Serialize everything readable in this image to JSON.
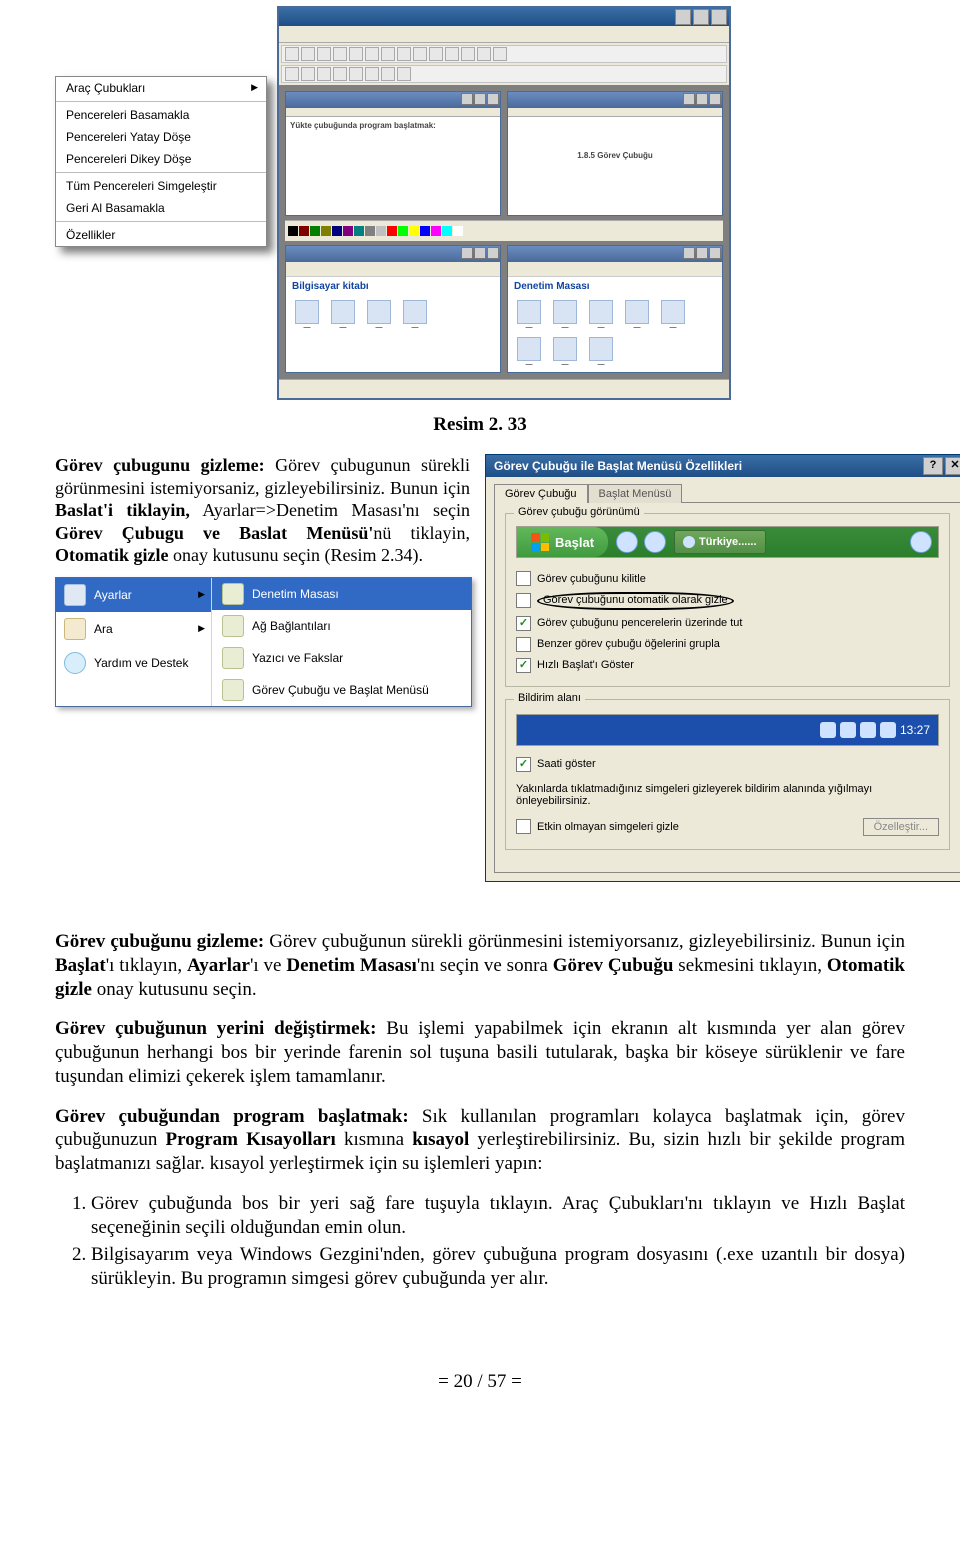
{
  "ctxMenu": {
    "items": [
      "Araç Çubukları",
      "Pencereleri Basamakla",
      "Pencereleri Yatay Döşe",
      "Pencereleri Dikey Döşe",
      "Tüm Pencereleri Simgeleştir",
      "Geri Al Basamakla",
      "Özellikler"
    ]
  },
  "mdi": {
    "topText1": "Yükte çubuğunda program başlatmak:",
    "topText2": "...",
    "paraHeading": "1.8.5 Görev Çubuğu",
    "folder1": "Bilgisayar kitabı",
    "folder2": "Denetim Masası"
  },
  "caption": "Resim 2. 33",
  "leadPara": {
    "strong1": "Görev çubugunu gizleme:",
    "t1": " Görev çubugunun    sürekli    görünmesini istemiyorsaniz, gizleyebilirsiniz. Bunun için ",
    "strong2": "Baslat'i  tiklayin,",
    "t2": " Ayarlar=>Denetim Masası'nı seçin ",
    "strong3": "Görev  Çubugu  ve  Baslat  Menüsü'",
    "t3": "nü tiklayin, ",
    "strong4": "Otomatik gizle",
    "t4": " onay kutusunu seçin (Resim 2.34)."
  },
  "startMenu": {
    "leftItems": [
      "Ayarlar",
      "Ara",
      "Yardım ve Destek"
    ],
    "rightItems": [
      "Denetim Masası",
      "Ağ Bağlantıları",
      "Yazıcı ve Fakslar",
      "Görev Çubuğu ve Başlat Menüsü"
    ]
  },
  "dialog": {
    "title": "Görev Çubuğu ile Başlat Menüsü Özellikleri",
    "tabs": [
      "Görev Çubuğu",
      "Başlat Menüsü"
    ],
    "fieldset1": "Görev çubuğu görünümü",
    "startLabel": "Başlat",
    "tbTabLabel": "Türkiye......",
    "options": [
      {
        "label": "Görev çubuğunu kilitle",
        "checked": false,
        "circled": false
      },
      {
        "label": "Görev çubuğunu otomatik olarak gizle",
        "checked": false,
        "circled": true
      },
      {
        "label": "Görev çubuğunu pencerelerin üzerinde tut",
        "checked": true,
        "circled": false
      },
      {
        "label": "Benzer görev çubuğu öğelerini grupla",
        "checked": false,
        "circled": false
      },
      {
        "label": "Hızlı Başlat'ı Göster",
        "checked": true,
        "circled": false
      }
    ],
    "fieldset2": "Bildirim alanı",
    "time": "13:27",
    "showClock": {
      "label": "Saati göster",
      "checked": true
    },
    "notifDesc": "Yakınlarda tıklatmadığınız simgeleri gizleyerek bildirim alanında yığılmayı önleyebilirsiniz.",
    "hideInactive": {
      "label": "Etkin olmayan simgeleri gizle",
      "checked": false
    },
    "customizeBtn": "Özelleştir..."
  },
  "body": {
    "p1": {
      "s1": "Görev çubuğunu gizleme:",
      "t1": " Görev çubuğunun sürekli görünmesini istemiyorsanız, gizleyebilirsiniz. Bunun için ",
      "s2": "Başlat",
      "t2": "'ı tıklayın, ",
      "s3": "Ayarlar",
      "t3": "'ı ve ",
      "s4": "Denetim Masası",
      "t4": "'nı seçin ve sonra ",
      "s5": "Görev Çubuğu",
      "t5": " sekmesini tıklayın, ",
      "s6": "Otomatik gizle",
      "t6": " onay kutusunu seçin."
    },
    "p2": {
      "s1": "Görev çubuğunun yerini değiştirmek:",
      "t1": " Bu işlemi yapabilmek için ekranın alt kısmında yer alan görev çubuğunun herhangi bos bir yerinde farenin sol tuşuna basili tutularak, başka bir köseye sürüklenir ve fare tuşundan elimizi çekerek işlem tamamlanır."
    },
    "p3": {
      "s1": "Görev çubuğundan program başlatmak:",
      "t1": " Sık kullanılan programları kolayca başlatmak için, görev çubuğunuzun ",
      "s2": "Program Kısayolları",
      "t2": " kısmına ",
      "s3": "kısayol",
      "t3": " yerleştirebilirsiniz. Bu, sizin hızlı bir şekilde program başlatmanızı sağlar. kısayol yerleştirmek için su işlemleri yapın:"
    },
    "steps": [
      {
        "t1": "Görev çubuğunda bos bir yeri sağ fare tuşuyla tıklayın. ",
        "s1": "Araç Çubukları",
        "t2": "'nı tıklayın ve ",
        "s2": "Hızlı Başlat",
        "t3": " seçeneğinin seçili olduğundan emin olun."
      },
      {
        "s1": "Bilgisayarım",
        "t1": " veya ",
        "s2": "Windows Gezgini",
        "t2": "'nden, görev çubuğuna program dosyasını (.exe uzantılı bir dosya) sürükleyin. Bu programın simgesi görev çubuğunda yer alır."
      }
    ]
  },
  "pageNum": "= 20 / 57 ="
}
